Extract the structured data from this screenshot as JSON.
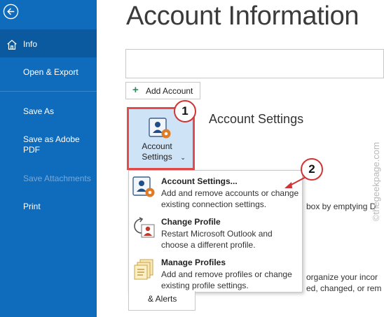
{
  "sidebar": {
    "items": [
      {
        "label": "Info",
        "active": true
      },
      {
        "label": "Open & Export"
      },
      {
        "label": "Save As"
      },
      {
        "label": "Save as Adobe PDF"
      },
      {
        "label": "Save Attachments",
        "disabled": true
      },
      {
        "label": "Print"
      }
    ]
  },
  "main": {
    "title": "Account Information",
    "add_account_label": "Add Account",
    "account_settings_button": "Account Settings",
    "account_settings_heading": "Account Settings",
    "background_text": [
      "box by emptying D",
      "organize your incor",
      "ed, changed, or rem"
    ],
    "alerts_label": "& Alerts"
  },
  "dropdown": {
    "items": [
      {
        "title": "Account Settings...",
        "description": "Add and remove accounts or change existing connection settings."
      },
      {
        "title": "Change Profile",
        "description": "Restart Microsoft Outlook and choose a different profile."
      },
      {
        "title": "Manage Profiles",
        "description": "Add and remove profiles or change existing profile settings."
      }
    ]
  },
  "annotations": {
    "badge1": "1",
    "badge2": "2"
  },
  "watermark": "©thegeekpage.com",
  "colors": {
    "sidebar": "#0f6cbd",
    "sidebar_active": "#0b5a9f",
    "highlight_border": "#e44b4b",
    "button_fill": "#cfe3f6"
  }
}
